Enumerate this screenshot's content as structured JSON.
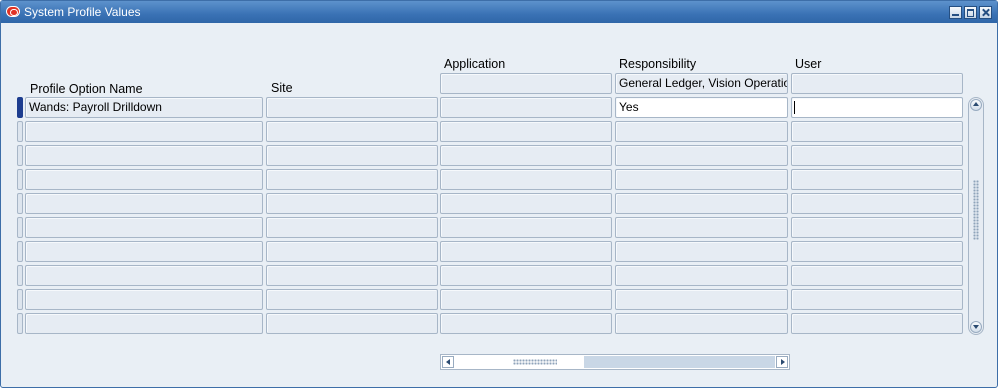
{
  "window": {
    "title": "System Profile Values",
    "minimize_icon": "minimize-icon",
    "maximize_icon": "maximize-icon",
    "close_icon": "close-icon"
  },
  "columns": {
    "profile_option_name": "Profile Option Name",
    "site": "Site",
    "application": "Application",
    "responsibility": "Responsibility",
    "user": "User"
  },
  "context": {
    "application": "",
    "responsibility": "General Ledger, Vision Operations (USA)",
    "user": ""
  },
  "rows": [
    {
      "profile_option_name": "Wands: Payroll Drilldown",
      "site": "",
      "application": "",
      "responsibility": "Yes",
      "user": ""
    },
    {
      "profile_option_name": "",
      "site": "",
      "application": "",
      "responsibility": "",
      "user": ""
    },
    {
      "profile_option_name": "",
      "site": "",
      "application": "",
      "responsibility": "",
      "user": ""
    },
    {
      "profile_option_name": "",
      "site": "",
      "application": "",
      "responsibility": "",
      "user": ""
    },
    {
      "profile_option_name": "",
      "site": "",
      "application": "",
      "responsibility": "",
      "user": ""
    },
    {
      "profile_option_name": "",
      "site": "",
      "application": "",
      "responsibility": "",
      "user": ""
    },
    {
      "profile_option_name": "",
      "site": "",
      "application": "",
      "responsibility": "",
      "user": ""
    },
    {
      "profile_option_name": "",
      "site": "",
      "application": "",
      "responsibility": "",
      "user": ""
    },
    {
      "profile_option_name": "",
      "site": "",
      "application": "",
      "responsibility": "",
      "user": ""
    },
    {
      "profile_option_name": "",
      "site": "",
      "application": "",
      "responsibility": "",
      "user": ""
    }
  ],
  "colors": {
    "titlebar": "#3a72b5",
    "window_bg": "#e9eff5",
    "current_record": "#1d3d8f"
  }
}
